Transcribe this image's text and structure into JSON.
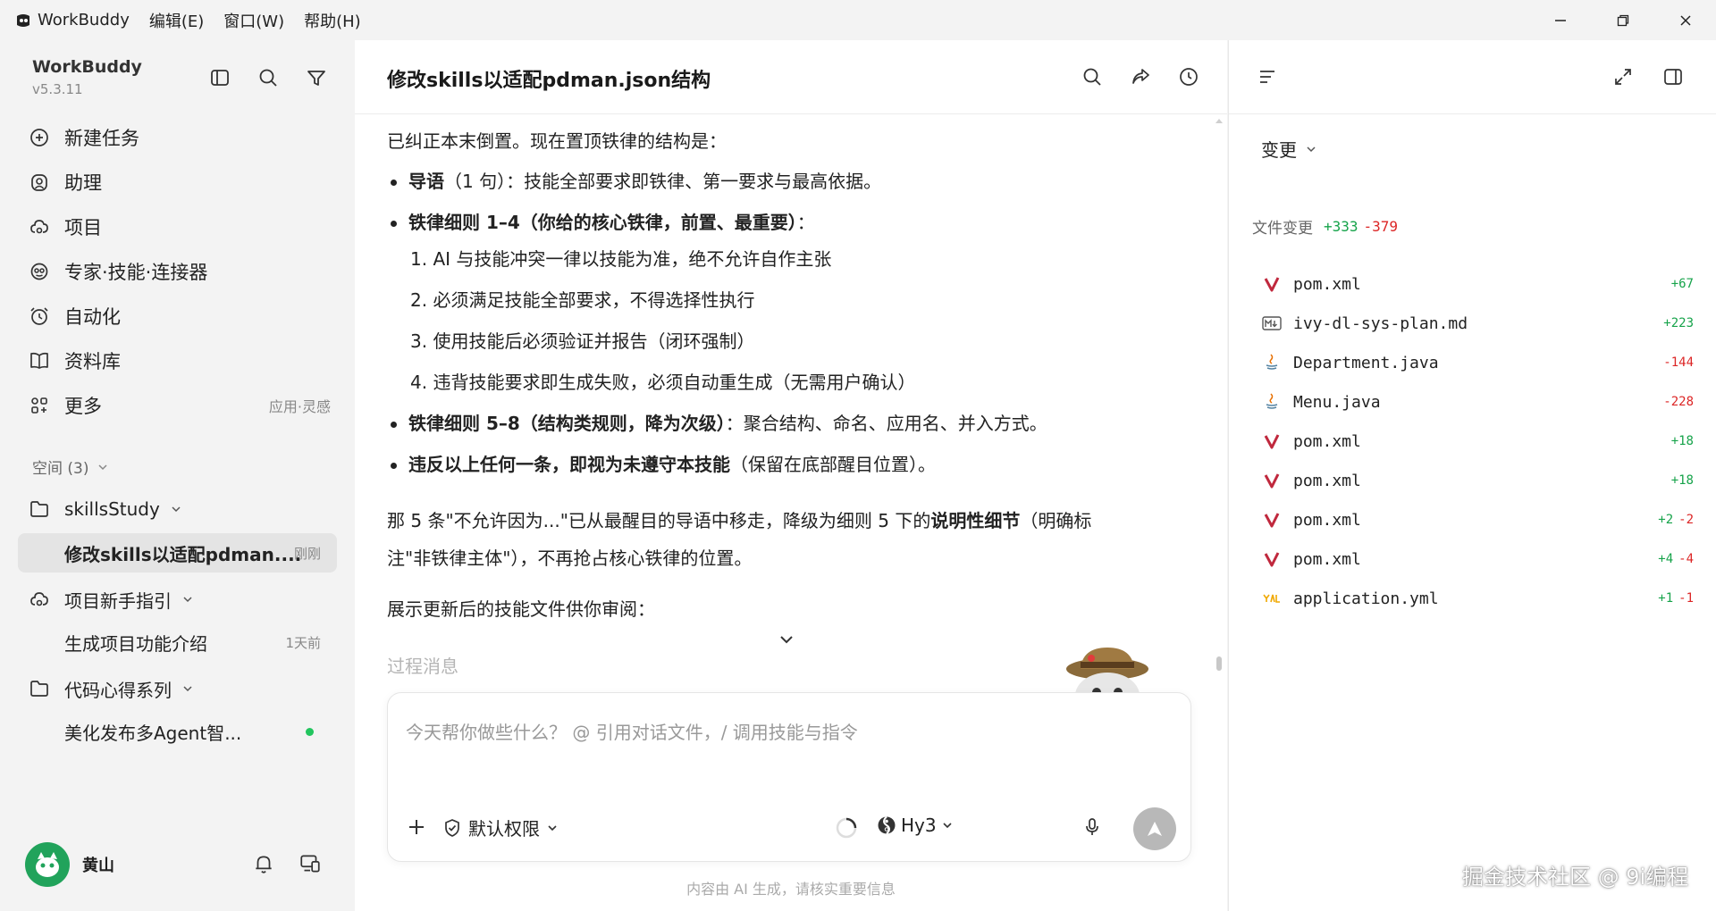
{
  "titlebar": {
    "app_name": "WorkBuddy",
    "menus": [
      "编辑(E)",
      "窗口(W)",
      "帮助(H)"
    ]
  },
  "sidebar": {
    "brand": "WorkBuddy",
    "version": "v5.3.11",
    "nav": [
      {
        "label": "新建任务",
        "icon": "plus-circle-icon"
      },
      {
        "label": "助理",
        "icon": "assistant-icon"
      },
      {
        "label": "项目",
        "icon": "project-icon"
      },
      {
        "label": "专家·技能·连接器",
        "icon": "expert-icon"
      },
      {
        "label": "自动化",
        "icon": "alarm-clock-icon"
      },
      {
        "label": "资料库",
        "icon": "book-icon"
      },
      {
        "label": "更多",
        "icon": "grid-icon",
        "hint": "应用·灵感"
      }
    ],
    "space_label": "空间 (3)",
    "groups": [
      {
        "name": "skillsStudy",
        "icon": "folder-icon",
        "tasks": [
          {
            "title": "修改skills以适配pdman....",
            "time": "刚刚",
            "active": true
          }
        ]
      },
      {
        "name": "项目新手指引",
        "icon": "project-icon",
        "tasks": [
          {
            "title": "生成项目功能介绍",
            "time": "1天前"
          }
        ]
      },
      {
        "name": "代码心得系列",
        "icon": "folder-icon",
        "tasks": [
          {
            "title": "美化发布多Agent智...",
            "status": "online"
          }
        ]
      }
    ],
    "user": {
      "name": "黄山"
    }
  },
  "main": {
    "title": "修改skills以适配pdman.json结构",
    "intro": "已纠正本末倒置。现在置顶铁律的结构是：",
    "b1_bold": "导语",
    "b1_rest": "（1 句）：技能全部要求即铁律、第一要求与最高依据。",
    "b2_bold": "铁律细则 1–4（你给的核心铁律，前置、最重要）",
    "b2_rest": "：",
    "rules": [
      "1. AI 与技能冲突一律以技能为准，绝不允许自作主张",
      "2. 必须满足技能全部要求，不得选择性执行",
      "3. 使用技能后必须验证并报告（闭环强制）",
      "4. 违背技能要求即生成失败，必须自动重生成（无需用户确认）"
    ],
    "b3_bold": "铁律细则 5–8（结构类规则，降为次级）",
    "b3_rest": "：聚合结构、命名、应用名、并入方式。",
    "b4_bold": "违反以上任何一条，即视为未遵守本技能",
    "b4_rest": "（保留在底部醒目位置）。",
    "para1_a": "那 5 条\"不允许因为...\"已从最醒目的导语中移走，降级为细则 5 下的",
    "para1_bold": "说明性细节",
    "para1_b": "（明确标",
    "para1_line2": "注\"非铁律主体\"），不再抢占核心铁律的位置。",
    "para2": "展示更新后的技能文件供你审阅：",
    "process_label": "过程消息",
    "composer": {
      "placeholder": "今天帮你做些什么？ @ 引用对话文件，/ 调用技能与指令",
      "permission": "默认权限",
      "model": "Hy3"
    },
    "footer": "内容由 AI 生成，请核实重要信息"
  },
  "right_panel": {
    "dropdown": "变更",
    "file_changes_label": "文件变更",
    "total_add": "+333",
    "total_del": "-379",
    "files": [
      {
        "name": "pom.xml",
        "icon": "maven-icon",
        "add": "+67",
        "del": ""
      },
      {
        "name": "ivy-dl-sys-plan.md",
        "icon": "markdown-icon",
        "add": "+223",
        "del": ""
      },
      {
        "name": "Department.java",
        "icon": "java-icon",
        "add": "",
        "del": "-144"
      },
      {
        "name": "Menu.java",
        "icon": "java-icon",
        "add": "",
        "del": "-228"
      },
      {
        "name": "pom.xml",
        "icon": "maven-icon",
        "add": "+18",
        "del": ""
      },
      {
        "name": "pom.xml",
        "icon": "maven-icon",
        "add": "+18",
        "del": ""
      },
      {
        "name": "pom.xml",
        "icon": "maven-icon",
        "add": "+2",
        "del": "-2"
      },
      {
        "name": "pom.xml",
        "icon": "maven-icon",
        "add": "+4",
        "del": "-4"
      },
      {
        "name": "application.yml",
        "icon": "yaml-icon",
        "add": "+1",
        "del": "-1"
      }
    ]
  },
  "watermark": "掘金技术社区 @ 9i编程",
  "colors": {
    "accent_green": "#21a35b",
    "add": "#16a34a",
    "del": "#dc2626",
    "send_btn": "#b8b8b8"
  }
}
